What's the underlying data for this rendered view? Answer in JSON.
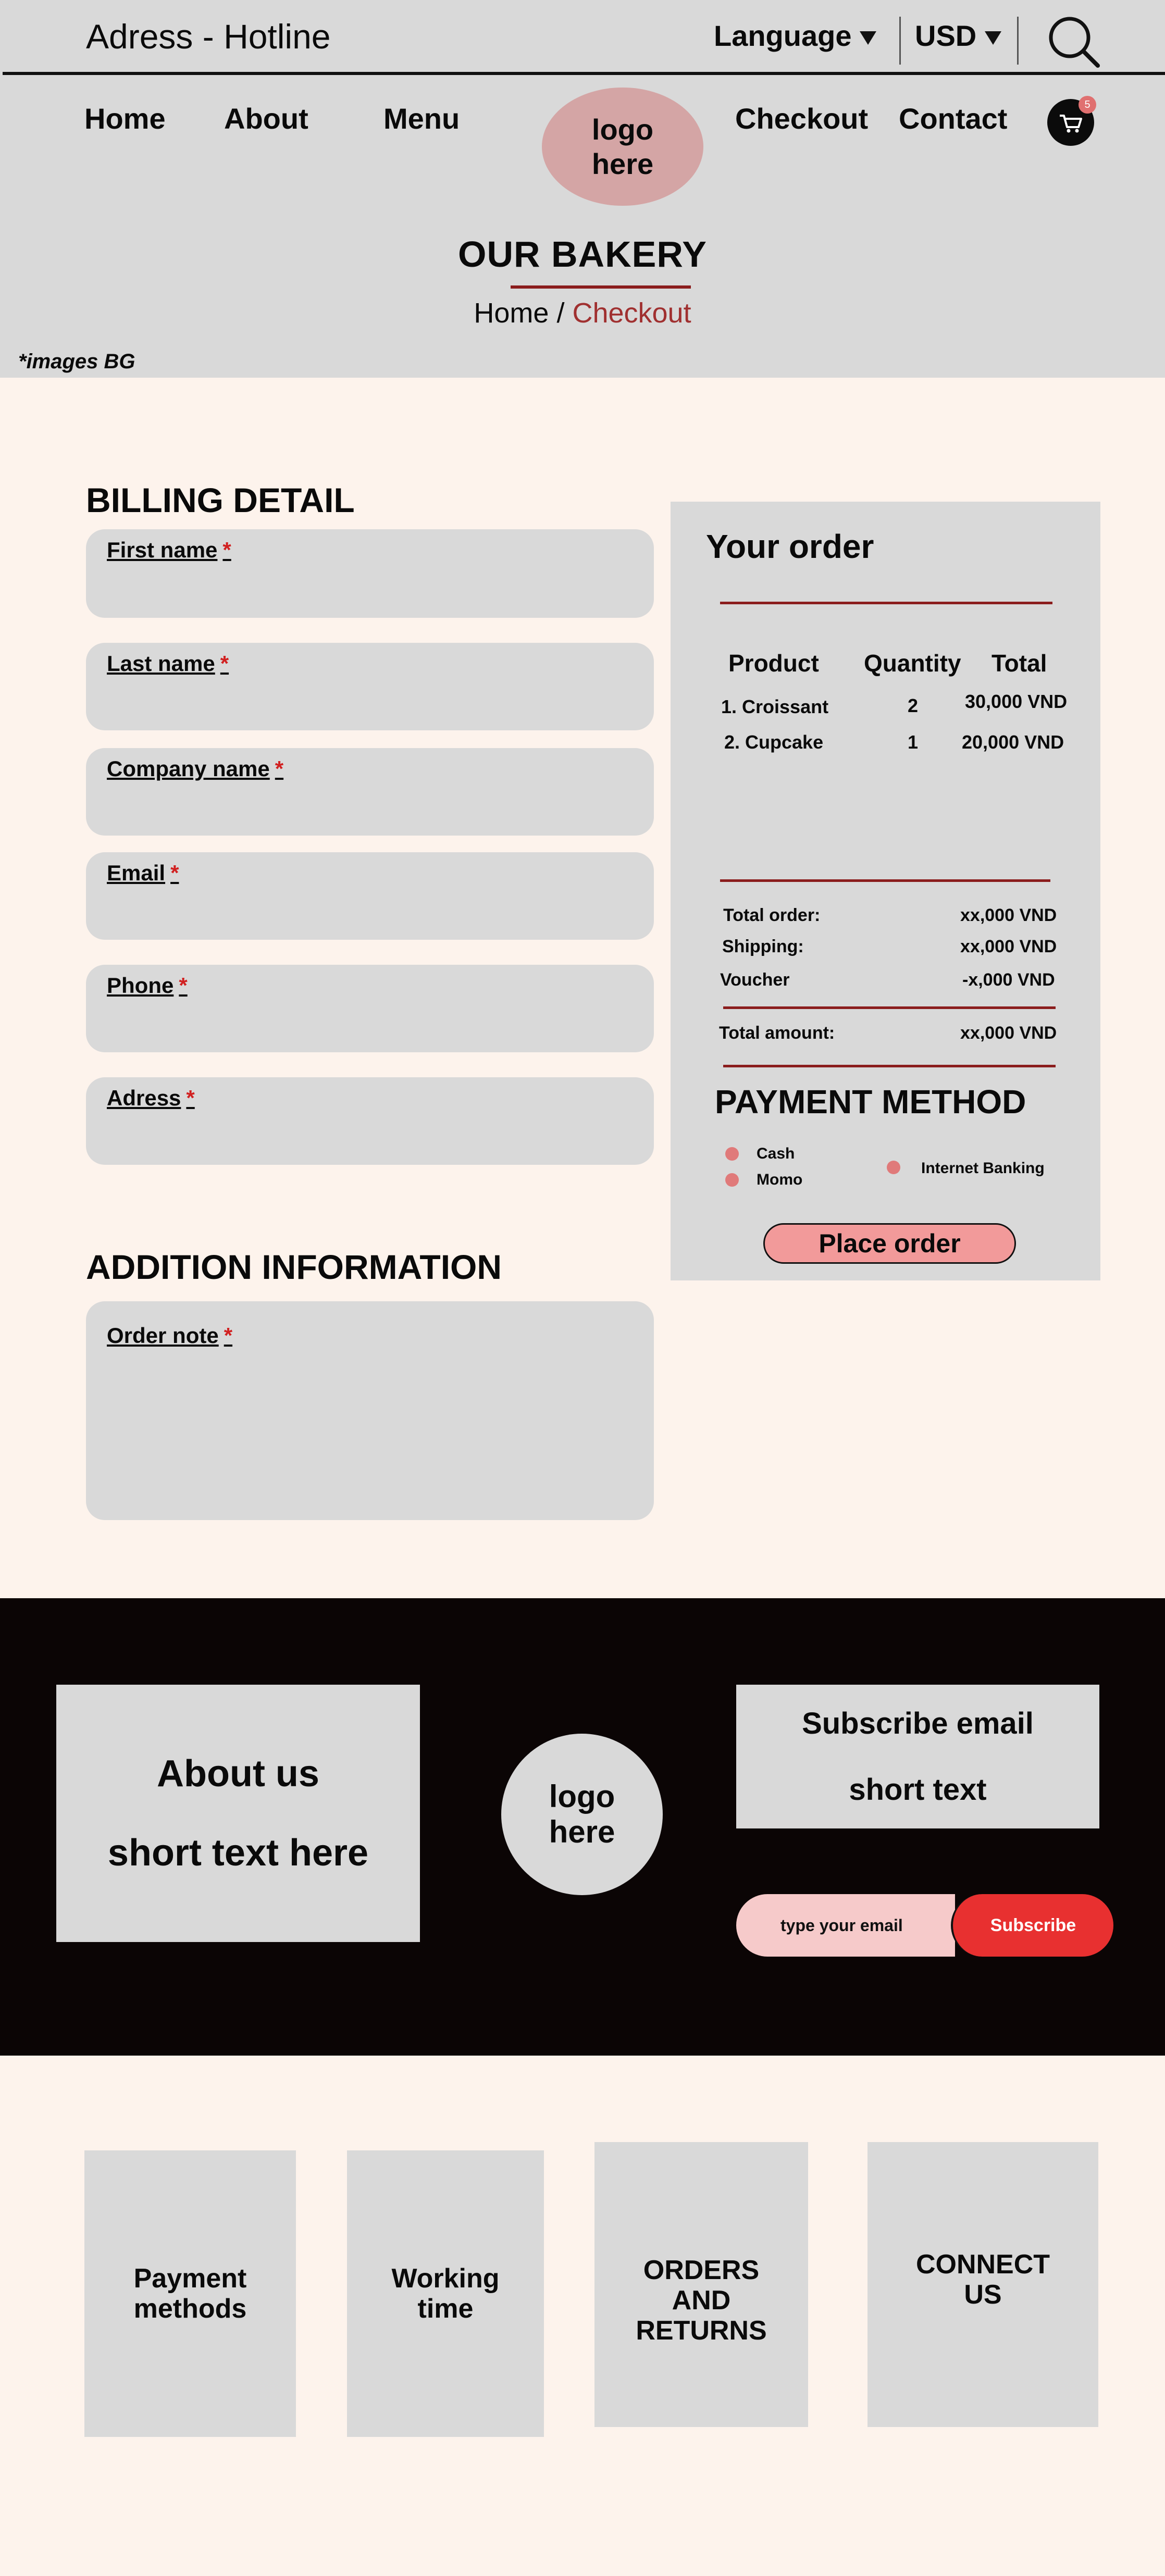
{
  "topbar": {
    "address_hotline": "Adress - Hotline",
    "language": "Language",
    "currency": "USD"
  },
  "nav": {
    "home": "Home",
    "about": "About",
    "menu": "Menu",
    "logo_line1": "logo",
    "logo_line2": "here",
    "checkout": "Checkout",
    "contact": "Contact",
    "cart_count": "5"
  },
  "hero": {
    "title": "OUR BAKERY",
    "breadcrumb_home": "Home",
    "breadcrumb_sep": " / ",
    "breadcrumb_current": "Checkout",
    "bg_note": "*images BG"
  },
  "billing": {
    "heading": "BILLING DETAIL",
    "required_mark": "*",
    "fields": [
      {
        "label": "First name"
      },
      {
        "label": "Last name"
      },
      {
        "label": "Company name"
      },
      {
        "label": "Email"
      },
      {
        "label": "Phone"
      },
      {
        "label": "Adress"
      }
    ]
  },
  "addition": {
    "heading": "ADDITION INFORMATION",
    "note_label": "Order note"
  },
  "order": {
    "heading": "Your order",
    "columns": [
      "Product",
      "Quantity",
      "Total"
    ],
    "items": [
      {
        "product": "1. Croissant",
        "quantity": "2",
        "total": "30,000 VND"
      },
      {
        "product": "2. Cupcake",
        "quantity": "1",
        "total": "20,000 VND"
      }
    ],
    "summary": {
      "total_order_label": "Total order:",
      "total_order_value": "xx,000 VND",
      "shipping_label": "Shipping:",
      "shipping_value": "xx,000 VND",
      "voucher_label": "Voucher",
      "voucher_value": "-x,000 VND",
      "total_amount_label": "Total amount:",
      "total_amount_value": "xx,000 VND"
    },
    "payment_heading": "PAYMENT METHOD",
    "payment_options": [
      "Cash",
      "Momo",
      "Internet Banking"
    ],
    "place_order": "Place order"
  },
  "footer": {
    "about_line1": "About us",
    "about_line2": "short text here",
    "logo_line1": "logo",
    "logo_line2": "here",
    "subscribe_line1": "Subscribe email",
    "subscribe_line2": "short text",
    "email_placeholder": "type your email",
    "subscribe_button": "Subscribe"
  },
  "info_boxes": {
    "payment_line1": "Payment",
    "payment_line2": "methods",
    "working_line1": "Working",
    "working_line2": "time",
    "orders_line1": "ORDERS",
    "orders_line2": "AND",
    "orders_line3": "RETURNS",
    "connect_line1": "CONNECT",
    "connect_line2": "US"
  },
  "colors": {
    "page_bg": "#fdf3ec",
    "header_bg": "#d9d9d9",
    "accent_dark_red": "#8b1d1d",
    "logo_pink": "#d4a5a5",
    "button_pink": "#f29a9a",
    "subscribe_red": "#e83030",
    "footer_bg": "#0b0505"
  }
}
